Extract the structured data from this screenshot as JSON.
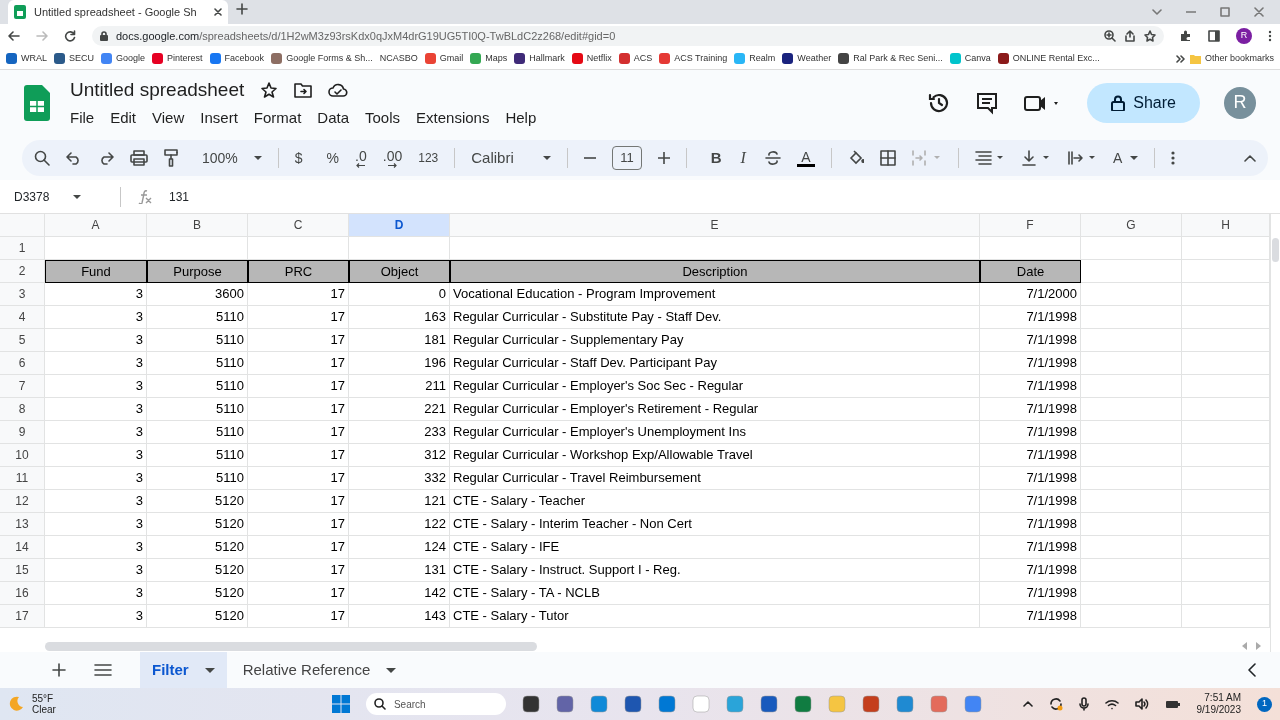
{
  "browser": {
    "tab_title": "Untitled spreadsheet - Google Sh",
    "url_host": "docs.google.com",
    "url_path": "/spreadsheets/d/1H2wM3z93rsKdx0qJxM4drG19UG5TI0Q-TwBLdC2z268/edit#gid=0",
    "avatar": "R",
    "bookmarks": [
      {
        "label": "WRAL",
        "icon": true
      },
      {
        "label": "SECU",
        "icon": true
      },
      {
        "label": "Google",
        "icon": true
      },
      {
        "label": "Pinterest",
        "icon": true
      },
      {
        "label": "Facebook",
        "icon": true
      },
      {
        "label": "Google Forms & Sh...",
        "icon": true
      },
      {
        "label": "NCASBO",
        "icon": false
      },
      {
        "label": "Gmail",
        "icon": true
      },
      {
        "label": "Maps",
        "icon": true
      },
      {
        "label": "Hallmark",
        "icon": true
      },
      {
        "label": "Netflix",
        "icon": true
      },
      {
        "label": "ACS",
        "icon": true
      },
      {
        "label": "ACS Training",
        "icon": true
      },
      {
        "label": "Realm",
        "icon": true
      },
      {
        "label": "Weather",
        "icon": true
      },
      {
        "label": "Ral Park & Rec Seni...",
        "icon": true
      },
      {
        "label": "Canva",
        "icon": true
      },
      {
        "label": "ONLINE Rental Exc...",
        "icon": true
      }
    ],
    "other_bookmarks": "Other bookmarks"
  },
  "app": {
    "title": "Untitled spreadsheet",
    "menus": [
      "File",
      "Edit",
      "View",
      "Insert",
      "Format",
      "Data",
      "Tools",
      "Extensions",
      "Help"
    ],
    "share": "Share",
    "avatar": "R",
    "toolbar": {
      "zoom": "100%",
      "currency": "$",
      "percent": "%",
      "decrease_decimal": ".0",
      "increase_decimal": ".00",
      "number_format": "123",
      "font": "Calibri",
      "font_size": "11",
      "bold": "B",
      "italic": "I",
      "text_color": "A",
      "text_rotation": "A"
    },
    "name_box": "D3378",
    "formula": "131",
    "columns": [
      {
        "letter": "A",
        "selected": false
      },
      {
        "letter": "B",
        "selected": false
      },
      {
        "letter": "C",
        "selected": false
      },
      {
        "letter": "D",
        "selected": true
      },
      {
        "letter": "E",
        "selected": false
      },
      {
        "letter": "F",
        "selected": false
      },
      {
        "letter": "G",
        "selected": false
      },
      {
        "letter": "H",
        "selected": false
      }
    ],
    "rows": [
      {
        "number": "1",
        "kind": "blank"
      },
      {
        "number": "2",
        "kind": "header",
        "cells": [
          "Fund",
          "Purpose",
          "PRC",
          "Object",
          "Description",
          "Date"
        ]
      },
      {
        "number": "3",
        "kind": "data",
        "cells": [
          "3",
          "3600",
          "17",
          "0",
          "Vocational Education - Program Improvement",
          "7/1/2000"
        ]
      },
      {
        "number": "4",
        "kind": "data",
        "cells": [
          "3",
          "5110",
          "17",
          "163",
          "Regular Curricular - Substitute Pay - Staff Dev.",
          "7/1/1998"
        ]
      },
      {
        "number": "5",
        "kind": "data",
        "cells": [
          "3",
          "5110",
          "17",
          "181",
          "Regular Curricular - Supplementary Pay",
          "7/1/1998"
        ]
      },
      {
        "number": "6",
        "kind": "data",
        "cells": [
          "3",
          "5110",
          "17",
          "196",
          "Regular Curricular - Staff Dev. Participant Pay",
          "7/1/1998"
        ]
      },
      {
        "number": "7",
        "kind": "data",
        "cells": [
          "3",
          "5110",
          "17",
          "211",
          "Regular Curricular - Employer's Soc Sec - Regular",
          "7/1/1998"
        ]
      },
      {
        "number": "8",
        "kind": "data",
        "cells": [
          "3",
          "5110",
          "17",
          "221",
          "Regular Curricular - Employer's Retirement - Regular",
          "7/1/1998"
        ]
      },
      {
        "number": "9",
        "kind": "data",
        "cells": [
          "3",
          "5110",
          "17",
          "233",
          "Regular Curricular - Employer's Unemployment Ins",
          "7/1/1998"
        ]
      },
      {
        "number": "10",
        "kind": "data",
        "cells": [
          "3",
          "5110",
          "17",
          "312",
          "Regular Curricular - Workshop Exp/Allowable Travel",
          "7/1/1998"
        ]
      },
      {
        "number": "11",
        "kind": "data",
        "cells": [
          "3",
          "5110",
          "17",
          "332",
          "Regular Curricular - Travel Reimbursement",
          "7/1/1998"
        ]
      },
      {
        "number": "12",
        "kind": "data",
        "cells": [
          "3",
          "5120",
          "17",
          "121",
          "CTE - Salary - Teacher",
          "7/1/1998"
        ]
      },
      {
        "number": "13",
        "kind": "data",
        "cells": [
          "3",
          "5120",
          "17",
          "122",
          "CTE - Salary - Interim Teacher - Non Cert",
          "7/1/1998"
        ]
      },
      {
        "number": "14",
        "kind": "data",
        "cells": [
          "3",
          "5120",
          "17",
          "124",
          "CTE - Salary - IFE",
          "7/1/1998"
        ]
      },
      {
        "number": "15",
        "kind": "data",
        "cells": [
          "3",
          "5120",
          "17",
          "131",
          "CTE - Salary - Instruct. Support I - Reg.",
          "7/1/1998"
        ]
      },
      {
        "number": "16",
        "kind": "data",
        "cells": [
          "3",
          "5120",
          "17",
          "142",
          "CTE - Salary - TA - NCLB",
          "7/1/1998"
        ]
      },
      {
        "number": "17",
        "kind": "data",
        "cells": [
          "3",
          "5120",
          "17",
          "143",
          "CTE - Salary - Tutor",
          "7/1/1998"
        ]
      }
    ],
    "sheets": [
      {
        "label": "Filter",
        "selected": true
      },
      {
        "label": "Relative Reference",
        "selected": false
      }
    ]
  },
  "taskbar": {
    "temperature": "55°F",
    "condition": "Clear",
    "search": "Search",
    "time": "7:51 AM",
    "date": "9/19/2023",
    "notifications": "1"
  }
}
